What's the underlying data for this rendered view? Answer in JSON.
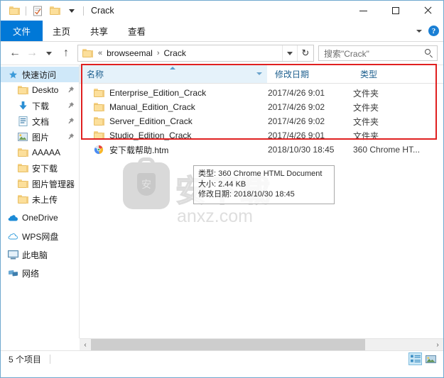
{
  "window": {
    "title": "Crack",
    "controls": {
      "minimize": "–",
      "maximize": "□",
      "close": "✕"
    }
  },
  "ribbon": {
    "tabs": [
      {
        "label": "文件",
        "active": true
      },
      {
        "label": "主页",
        "active": false
      },
      {
        "label": "共享",
        "active": false
      },
      {
        "label": "查看",
        "active": false
      }
    ],
    "help_label": "?"
  },
  "addressbar": {
    "back_glyph": "←",
    "forward_glyph": "→",
    "up_glyph": "↑",
    "prefix": "«",
    "crumbs": [
      "browseemal",
      "Crack"
    ],
    "separator": "›",
    "refresh_glyph": "↻"
  },
  "search": {
    "placeholder": "搜索\"Crack\"",
    "value": "搜索\"Crack\""
  },
  "sidebar": {
    "items": [
      {
        "label": "快速访问",
        "icon": "star-icon",
        "selected": true,
        "indent": false,
        "pinned": false
      },
      {
        "label": "Deskto",
        "icon": "folder-icon",
        "selected": false,
        "indent": true,
        "pinned": true
      },
      {
        "label": "下载",
        "icon": "download-icon",
        "selected": false,
        "indent": true,
        "pinned": true
      },
      {
        "label": "文档",
        "icon": "document-icon",
        "selected": false,
        "indent": true,
        "pinned": true
      },
      {
        "label": "图片",
        "icon": "picture-icon",
        "selected": false,
        "indent": true,
        "pinned": true
      },
      {
        "label": "AAAAA",
        "icon": "folder-icon",
        "selected": false,
        "indent": true,
        "pinned": false
      },
      {
        "label": "安下载",
        "icon": "folder-icon",
        "selected": false,
        "indent": true,
        "pinned": false
      },
      {
        "label": "图片管理器",
        "icon": "folder-icon",
        "selected": false,
        "indent": true,
        "pinned": false
      },
      {
        "label": "未上传",
        "icon": "folder-icon",
        "selected": false,
        "indent": true,
        "pinned": false
      },
      {
        "label": "OneDrive",
        "icon": "onedrive-icon",
        "selected": false,
        "indent": false,
        "pinned": false
      },
      {
        "label": "WPS网盘",
        "icon": "cloud-icon",
        "selected": false,
        "indent": false,
        "pinned": false
      },
      {
        "label": "此电脑",
        "icon": "computer-icon",
        "selected": false,
        "indent": false,
        "pinned": false
      },
      {
        "label": "网络",
        "icon": "network-icon",
        "selected": false,
        "indent": false,
        "pinned": false
      }
    ]
  },
  "filelist": {
    "columns": [
      "名称",
      "修改日期",
      "类型"
    ],
    "sort": "ascending",
    "rows": [
      {
        "name": "Enterprise_Edition_Crack",
        "date": "2017/4/26 9:01",
        "type": "文件夹",
        "icon": "folder-icon"
      },
      {
        "name": "Manual_Edition_Crack",
        "date": "2017/4/26 9:02",
        "type": "文件夹",
        "icon": "folder-icon"
      },
      {
        "name": "Server_Edition_Crack",
        "date": "2017/4/26 9:02",
        "type": "文件夹",
        "icon": "folder-icon"
      },
      {
        "name": "Studio_Edition_Crack",
        "date": "2017/4/26 9:01",
        "type": "文件夹",
        "icon": "folder-icon"
      },
      {
        "name": "安下载帮助.htm",
        "date": "2018/10/30 18:45",
        "type": "360 Chrome HT...",
        "icon": "chrome-html-icon"
      }
    ]
  },
  "tooltip": {
    "lines": [
      "类型: 360 Chrome HTML Document",
      "大小: 2.44 KB",
      "修改日期: 2018/10/30 18:45"
    ]
  },
  "watermark": {
    "badge_char": "安",
    "text": "安下载",
    "url": "anxz.com"
  },
  "statusbar": {
    "item_count": "5 个项目"
  },
  "scrollbar": {
    "left_glyph": "‹",
    "right_glyph": "›"
  },
  "colors": {
    "accent": "#0078d7",
    "header_text": "#1d5f8e",
    "annotation": "#e02020",
    "selection": "#cfe8f9"
  }
}
